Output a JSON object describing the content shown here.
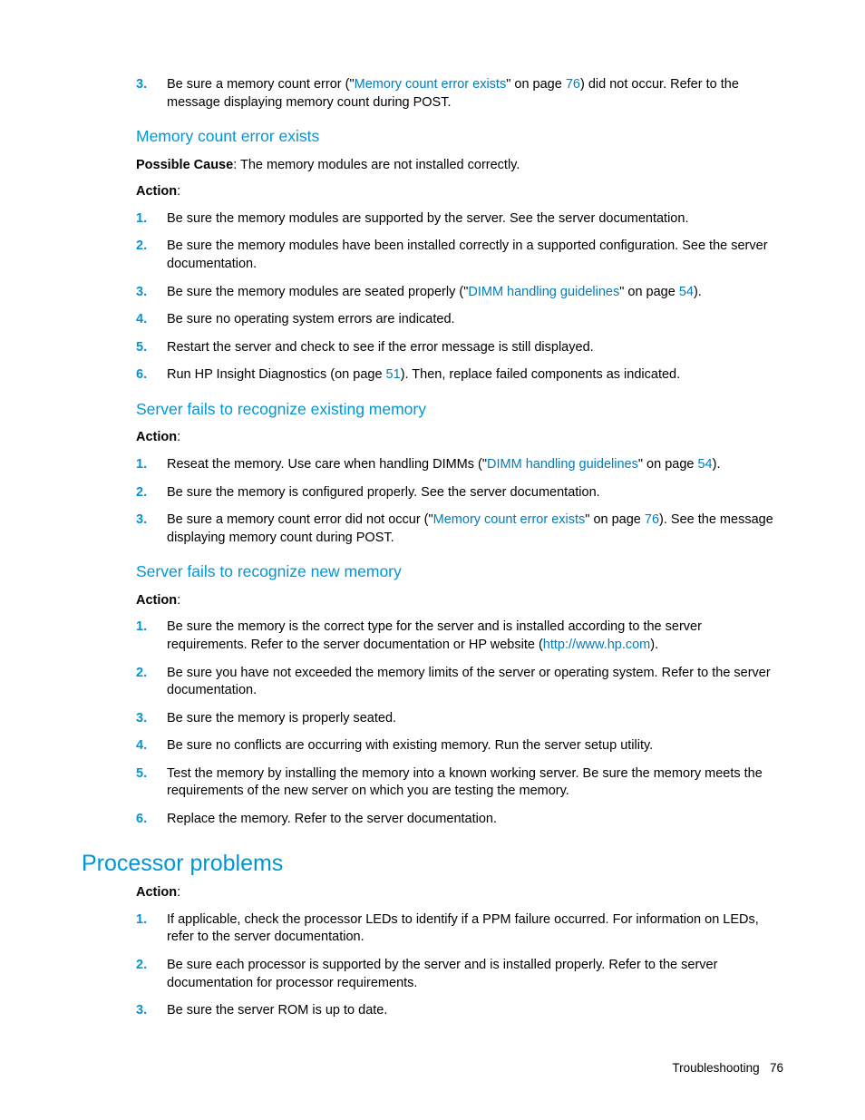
{
  "intro_item": {
    "num": "3.",
    "t1": "Be sure a memory count error (\"",
    "link1": "Memory count error exists",
    "t2": "\" on page ",
    "link2": "76",
    "t3": ") did not occur. Refer to the message displaying memory count during POST."
  },
  "s1": {
    "heading": "Memory count error exists",
    "cause_label": "Possible Cause",
    "cause_text": ": The memory modules are not installed correctly.",
    "action_label": "Action",
    "items": {
      "i1": {
        "num": "1.",
        "text": "Be sure the memory modules are supported by the server. See the server documentation."
      },
      "i2": {
        "num": "2.",
        "text": "Be sure the memory modules have been installed correctly in a supported configuration. See the server documentation."
      },
      "i3": {
        "num": "3.",
        "t1": "Be sure the memory modules are seated properly (\"",
        "link1": "DIMM handling guidelines",
        "t2": "\" on page ",
        "link2": "54",
        "t3": ")."
      },
      "i4": {
        "num": "4.",
        "text": "Be sure no operating system errors are indicated."
      },
      "i5": {
        "num": "5.",
        "text": "Restart the server and check to see if the error message is still displayed."
      },
      "i6": {
        "num": "6.",
        "t1": "Run HP Insight Diagnostics (on page ",
        "link1": "51",
        "t2": "). Then, replace failed components as indicated."
      }
    }
  },
  "s2": {
    "heading": "Server fails to recognize existing memory",
    "action_label": "Action",
    "items": {
      "i1": {
        "num": "1.",
        "t1": "Reseat the memory. Use care when handling DIMMs (\"",
        "link1": "DIMM handling guidelines",
        "t2": "\" on page ",
        "link2": "54",
        "t3": ")."
      },
      "i2": {
        "num": "2.",
        "text": "Be sure the memory is configured properly. See the server documentation."
      },
      "i3": {
        "num": "3.",
        "t1": "Be sure a memory count error did not occur (\"",
        "link1": "Memory count error exists",
        "t2": "\" on page ",
        "link2": "76",
        "t3": "). See the message displaying memory count during POST."
      }
    }
  },
  "s3": {
    "heading": "Server fails to recognize new memory",
    "action_label": "Action",
    "items": {
      "i1": {
        "num": "1.",
        "t1": "Be sure the memory is the correct type for the server and is installed according to the server requirements. Refer to the server documentation or HP website (",
        "link1": "http://www.hp.com",
        "t2": ")."
      },
      "i2": {
        "num": "2.",
        "text": "Be sure you have not exceeded the memory limits of the server or operating system. Refer to the server documentation."
      },
      "i3": {
        "num": "3.",
        "text": "Be sure the memory is properly seated."
      },
      "i4": {
        "num": "4.",
        "text": "Be sure no conflicts are occurring with existing memory. Run the server setup utility."
      },
      "i5": {
        "num": "5.",
        "text": "Test the memory by installing the memory into a known working server. Be sure the memory meets the requirements of the new server on which you are testing the memory."
      },
      "i6": {
        "num": "6.",
        "text": "Replace the memory. Refer to the server documentation."
      }
    }
  },
  "s4": {
    "heading": "Processor problems",
    "action_label": "Action",
    "items": {
      "i1": {
        "num": "1.",
        "text": "If applicable, check the processor LEDs to identify if a PPM failure occurred. For information on LEDs, refer to the server documentation."
      },
      "i2": {
        "num": "2.",
        "text": "Be sure each processor is supported by the server and is installed properly. Refer to the server documentation for processor requirements."
      },
      "i3": {
        "num": "3.",
        "text": "Be sure the server ROM is up to date."
      }
    }
  },
  "footer": {
    "section": "Troubleshooting",
    "page": "76"
  }
}
